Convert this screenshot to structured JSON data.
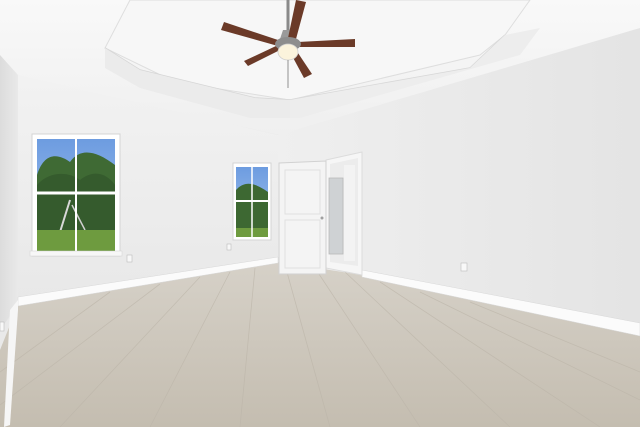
{
  "scene": {
    "kind": "empty-room-interior",
    "elements": [
      "tray-ceiling",
      "ceiling-fan",
      "left-wall-window",
      "center-wall-window",
      "interior-door",
      "hallway-doorway",
      "light-wood-floor",
      "baseboards",
      "wall-outlets"
    ]
  },
  "colors": {
    "wall_light": "#f1f1f1",
    "wall_shade": "#e6e6e6",
    "ceiling": "#f6f6f6",
    "floor": "#c9c3b8",
    "floor_plank_line": "#b9b2a6",
    "baseboard": "#fbfbfb",
    "sky": "#7fa9e0",
    "foliage": "#3e6b35",
    "grass": "#6e9b3f",
    "fan_blade": "#6b3a28",
    "fan_metal": "#8d8d8d",
    "door": "#f4f4f4"
  },
  "ceiling_fan": {
    "blades": 5,
    "light_kit": true
  },
  "windows": [
    {
      "location": "left-wall",
      "panes": "double-hung",
      "view": "trees-and-lawn"
    },
    {
      "location": "center-wall",
      "panes": "double-hung",
      "view": "trees-and-lawn"
    }
  ]
}
